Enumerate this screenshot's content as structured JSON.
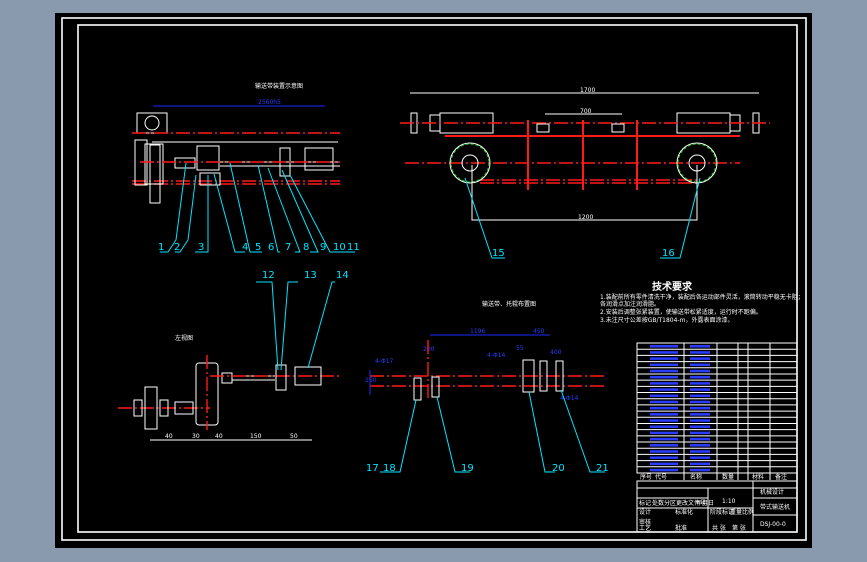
{
  "drawing": {
    "top_view_title": "输送带装置示意图",
    "overall_dim_top": "2560h5",
    "front_width_dim": "1700",
    "front_center_dim": "700",
    "front_bottom_dim": "1200",
    "side_view_label": "左视图",
    "side_dims": [
      "40",
      "30",
      "40",
      "150",
      "50"
    ],
    "layout_title": "输送带、托辊布置图",
    "layout_dims": {
      "span": "1196",
      "right": "450",
      "left": "200",
      "holes_left": "4-Φ17",
      "holes_right": "4-Φ14",
      "small": "55",
      "width2": "400",
      "hole_bottom": "4-Φ14",
      "height": "150"
    },
    "balloons": [
      "1",
      "2",
      "3",
      "4",
      "5",
      "6",
      "7",
      "8",
      "9",
      "10",
      "11",
      "12",
      "13",
      "14",
      "15",
      "16",
      "17",
      "18",
      "19",
      "20",
      "21"
    ]
  },
  "technical_requirements": {
    "title": "技术要求",
    "items": [
      "1.装配前所有零件清洗干净，装配后各运动部件灵活，滚筒转动平稳无卡阻；",
      "  各润滑点加注润滑脂。",
      "2.安装后调整张紧装置，使输送带松紧适度，运行时不跑偏。",
      "3.未注尺寸公差按GB/T1804-m，外露表面涂漆。"
    ]
  },
  "parts_list": {
    "rows": 21,
    "header": [
      "序号",
      "代号",
      "名称",
      "数量",
      "材料",
      "备注"
    ]
  },
  "title_block": {
    "drawing_name": "带式输送机",
    "scale": "1:10",
    "company": "机械设计",
    "drawing_no": "DSJ-00-0",
    "labels": [
      "标记",
      "处数",
      "分区",
      "更改文件号",
      "签名",
      "年月日",
      "设计",
      "标准化",
      "审核",
      "工艺",
      "批准",
      "阶段标记",
      "重量",
      "比例",
      "共 张",
      "第 张"
    ]
  }
}
